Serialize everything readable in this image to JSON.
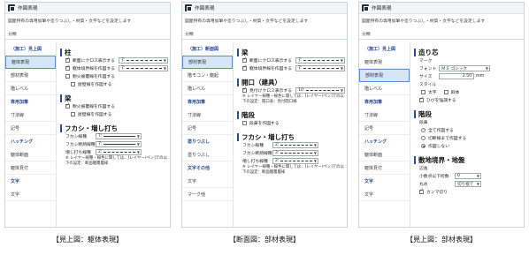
{
  "window_title": "作図表現",
  "description": "図面特有の専用加筆や塗りつぶし・材質・文字などを設定します",
  "category_label": "分類",
  "panels": [
    {
      "caption": "【見上図：躯体表現】",
      "sidebar": [
        "（施工）見上図",
        "躯体表現",
        "部材表現",
        "階レベル",
        "専用加筆",
        "寸法線",
        "記号",
        "ハッチング",
        "躯体断面",
        "躯体見付",
        "文字",
        "文字"
      ],
      "s1": "柱",
      "s1_rows": [
        "断面にクロス表示する",
        "躯体境界線を作図する",
        "耐火被覆線を作図する",
        "屋壁線を作図する"
      ],
      "s2": "梁",
      "s2_rows": [
        "耐火被覆線を作図する",
        "屋壁線を作図する"
      ],
      "s3": "フカシ・増し打ち",
      "s3_rows": [
        "フカシ線種",
        "フカシ断熱線種",
        "増し打ち線種"
      ],
      "val_7": "7:",
      "val_2": "2:",
      "note": "※ レイヤー線種・線色に関しては、[レイヤー/ペン]での以下の設定：断面躯覆層様"
    },
    {
      "caption": "【断面図：部材表現】",
      "sidebar": [
        "（施工）断面図",
        "部材表現",
        "階モコン・躯起",
        "階レベル",
        "専用加筆",
        "寸法線",
        "記号",
        "塗りつぶし",
        "塗りつぶし",
        "文字その他",
        "文字",
        "マーク他"
      ],
      "s1": "梁",
      "s1_rows": [
        "断面にクロス表示する",
        "躯体境界線を作図する"
      ],
      "s2": "開口（建具）",
      "s2_rows": [
        "見付けクロス表示する"
      ],
      "s2_val": "10:",
      "s2_note": "※ レイヤー線種・線色に関しては、[レイヤー/ペン]での以下の設定：開口表：見付開口線",
      "s3": "階段",
      "s3_rows": [
        "段鼻を作図する"
      ],
      "s4": "フカシ・増し打ち",
      "s4_rows": [
        "フカシ線種",
        "フカシ断熱線種",
        "増し打ち線種"
      ],
      "val_2": "2:",
      "note": "※ レイヤー線種・線色に関しては、[レイヤー/ペン]での以下の設定：断面躯覆層様"
    },
    {
      "caption": "【見上図：部材表現】",
      "sidebar": [
        "（施工）見上図",
        "躯体表現",
        "部材表現",
        "階レベル",
        "専用加筆",
        "寸法線",
        "記号",
        "ハッチング",
        "躯体断面",
        "躯体見付",
        "文字",
        "文字"
      ],
      "s1": "造り芯",
      "mark_label": "マーク",
      "font_label": "フォント",
      "font_value": "ＭＳ ゴシック",
      "size_label": "サイズ",
      "size_value": "2.50",
      "size_unit": "mm",
      "style_label": "スタイル",
      "style_rows": [
        "太字",
        "斜体"
      ],
      "s1_check": "ひびを強調する",
      "s2": "階段",
      "stair_label": "段鼻",
      "stair_rows": [
        "全て作図する",
        "切断線まで作図する",
        "作図しない"
      ],
      "s3": "敷地境界・地盤",
      "s3_rows": [
        "辺長",
        "小数点以下桁数",
        "丸め"
      ],
      "round_value": "切り捨て",
      "digits_value": "0",
      "s3_check": "カンマ切り"
    }
  ]
}
